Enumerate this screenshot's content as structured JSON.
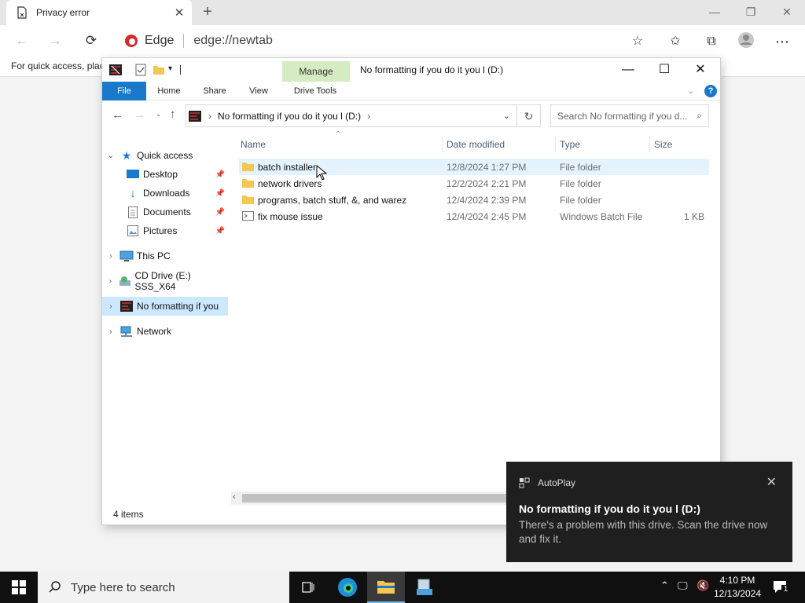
{
  "browser": {
    "tab_title": "Privacy error",
    "brand": "Edge",
    "url": "edge://newtab",
    "favorites_text": "For quick access, plac"
  },
  "explorer": {
    "manage_tab": "Manage",
    "window_title": "No formatting if you do it you l (D:)",
    "ribbon_tabs": {
      "file": "File",
      "home": "Home",
      "share": "Share",
      "view": "View",
      "drive_tools": "Drive Tools"
    },
    "address_path": "No formatting if you do it you l (D:)",
    "search_placeholder": "Search No formatting if you d...",
    "nav": {
      "quick_access": "Quick access",
      "desktop": "Desktop",
      "downloads": "Downloads",
      "documents": "Documents",
      "pictures": "Pictures",
      "this_pc": "This PC",
      "cd_drive": "CD Drive (E:) SSS_X64",
      "no_formatting": "No formatting if you",
      "network": "Network"
    },
    "columns": {
      "name": "Name",
      "date": "Date modified",
      "type": "Type",
      "size": "Size"
    },
    "files": [
      {
        "name": "batch installer",
        "date": "12/8/2024 1:27 PM",
        "type": "File folder",
        "size": ""
      },
      {
        "name": "network drivers",
        "date": "12/2/2024 2:21 PM",
        "type": "File folder",
        "size": ""
      },
      {
        "name": "programs, batch stuff, &, and warez",
        "date": "12/4/2024 2:39 PM",
        "type": "File folder",
        "size": ""
      },
      {
        "name": "fix mouse issue",
        "date": "12/4/2024 2:45 PM",
        "type": "Windows Batch File",
        "size": "1 KB"
      }
    ],
    "status": "4 items"
  },
  "toast": {
    "app": "AutoPlay",
    "title": "No formatting if you do it you l (D:)",
    "body": "There's a problem with this drive.  Scan the drive now and fix it."
  },
  "taskbar": {
    "search_placeholder": "Type here to search",
    "time": "4:10 PM",
    "date": "12/13/2024",
    "notifications": "1"
  },
  "colors": {
    "accent": "#1979ca",
    "selection": "#e5f3ff",
    "manage_tab": "#d5ebc2",
    "edge_red": "#d42a2a"
  }
}
